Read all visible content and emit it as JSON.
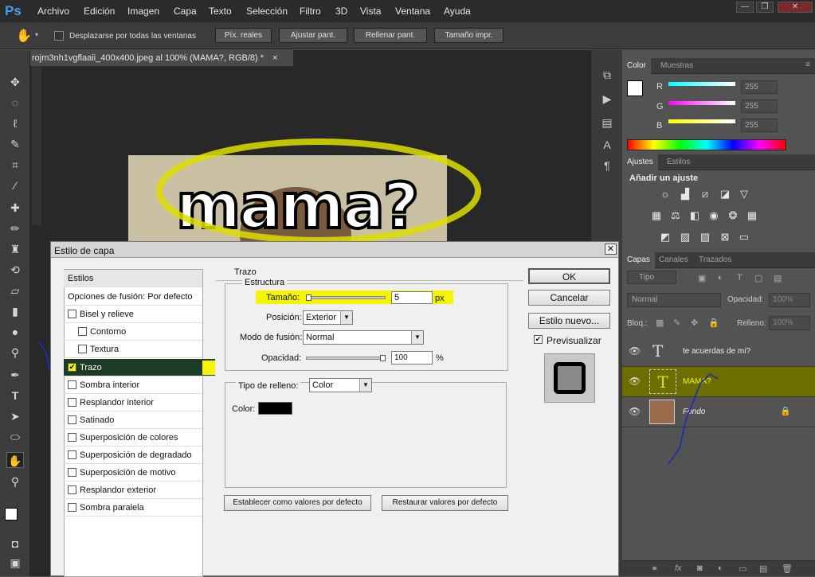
{
  "app": {
    "logo": "Ps",
    "menu": [
      "Archivo",
      "Edición",
      "Imagen",
      "Capa",
      "Texto",
      "Selección",
      "Filtro",
      "3D",
      "Vista",
      "Ventana",
      "Ayuda"
    ],
    "window_controls": [
      "—",
      "❐",
      "✕"
    ]
  },
  "options_bar": {
    "scroll_all_label": "Desplazarse por todas las ventanas",
    "buttons": [
      "Píx. reales",
      "Ajustar pant.",
      "Rellenar pant.",
      "Tamaño impr."
    ]
  },
  "document": {
    "tab_title": "rojm3nh1vgflaaii_400x400.jpeg al 100% (MAMA?, RGB/8) *",
    "canvas_text": "mama?"
  },
  "color_panel": {
    "tabs": [
      "Color",
      "Muestras"
    ],
    "channels": [
      {
        "label": "R",
        "value": "255"
      },
      {
        "label": "G",
        "value": "255"
      },
      {
        "label": "B",
        "value": "255"
      }
    ]
  },
  "adjust_panel": {
    "tabs": [
      "Ajustes",
      "Estilos"
    ],
    "heading": "Añadir un ajuste"
  },
  "layers_panel": {
    "tabs": [
      "Capas",
      "Canales",
      "Trazados"
    ],
    "filter_kind": "Tipo",
    "blend_mode": "Normal",
    "opacity_label": "Opacidad:",
    "opacity_value": "100%",
    "lock_label": "Bloq.:",
    "fill_label": "Relleno:",
    "fill_value": "100%",
    "layers": [
      {
        "name": "te acuerdas de mi?",
        "type": "text"
      },
      {
        "name": "MAMA?",
        "type": "text"
      },
      {
        "name": "Fondo",
        "type": "image"
      }
    ]
  },
  "dialog": {
    "title": "Estilo de capa",
    "styles_header": "Estilos",
    "blend_options": "Opciones de fusión: Por defecto",
    "style_items": [
      {
        "label": "Bisel y relieve",
        "checked": false
      },
      {
        "label": "Contorno",
        "checked": false
      },
      {
        "label": "Textura",
        "checked": false
      },
      {
        "label": "Trazo",
        "checked": true
      },
      {
        "label": "Sombra interior",
        "checked": false
      },
      {
        "label": "Resplandor interior",
        "checked": false
      },
      {
        "label": "Satinado",
        "checked": false
      },
      {
        "label": "Superposición de colores",
        "checked": false
      },
      {
        "label": "Superposición de degradado",
        "checked": false
      },
      {
        "label": "Superposición de motivo",
        "checked": false
      },
      {
        "label": "Resplandor exterior",
        "checked": false
      },
      {
        "label": "Sombra paralela",
        "checked": false
      }
    ],
    "section_title": "Trazo",
    "structure_title": "Estructura",
    "size_label": "Tamaño:",
    "size_value": "5",
    "size_unit": "px",
    "position_label": "Posición:",
    "position_value": "Exterior",
    "blend_label": "Modo de fusión:",
    "blend_value": "Normal",
    "opacity_label": "Opacidad:",
    "opacity_value": "100",
    "opacity_unit": "%",
    "fill_type_label": "Tipo de relleno:",
    "fill_type_value": "Color",
    "color_label": "Color:",
    "stroke_color": "#000000",
    "default_btn": "Establecer como valores por defecto",
    "reset_btn": "Restaurar valores por defecto",
    "ok": "OK",
    "cancel": "Cancelar",
    "new_style": "Estilo nuevo...",
    "preview_label": "Previsualizar",
    "preview_checked": true
  },
  "colors": {
    "highlight_yellow": "#f5f500",
    "selected_layer": "#6e6e00",
    "ps_blue": "#3fa0f2"
  }
}
